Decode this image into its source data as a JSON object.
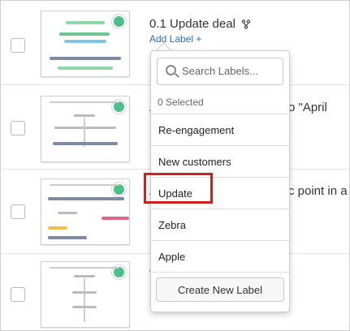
{
  "rows": [
    {
      "title": "0.1 Update deal",
      "add_label": "Add Label +",
      "branch_icon": "branch-icon"
    },
    {
      "title": "A",
      "title_right": "o \"April"
    },
    {
      "title": "A",
      "title_right": "c point in a",
      "sub": "("
    },
    {
      "title": "V",
      "sub": "("
    }
  ],
  "dropdown": {
    "search_placeholder": "Search Labels...",
    "selected_count": "0 Selected",
    "options": [
      "Re-engagement",
      "New customers",
      "Update",
      "Zebra",
      "Apple"
    ],
    "create_button": "Create New Label"
  },
  "colors": {
    "status_dot": "#4cc08a",
    "link": "#2b6cc4",
    "highlight": "#d0201e"
  }
}
